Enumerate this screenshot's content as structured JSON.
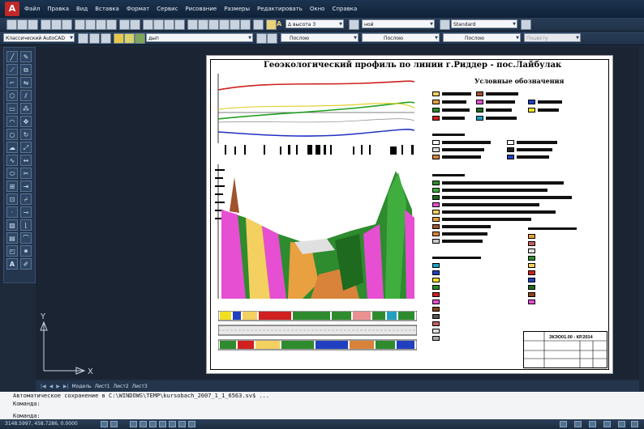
{
  "app": {
    "logo_text": "A"
  },
  "menu": [
    "Файл",
    "Правка",
    "Вид",
    "Вставка",
    "Формат",
    "Сервис",
    "Рисование",
    "Размеры",
    "Редактировать",
    "Окно",
    "Справка"
  ],
  "toolbar1": {
    "dim_style_label": "A",
    "dim_combo": "Δ высота 3",
    "layer_combo": "ной",
    "style_combo": "Standard"
  },
  "toolbar2": {
    "workspace_combo": "Классический AutoCAD",
    "layer_name": "дып",
    "color_combo": "Послою",
    "linetype_combo": "Послою",
    "lineweight_combo": "Послою",
    "plotstyle_combo": "Поцвету"
  },
  "drawing": {
    "ucs_y": "Y",
    "ucs_x": "X",
    "sheet_title": "Геоэкологический профиль по линии г.Риддер - пос.Лайбулак",
    "legend_title": "Условные обозначения",
    "stamp_code": "ЗКЭО01.00 - КР.2014"
  },
  "tabs": [
    "Модель",
    "Лист1",
    "Лист2",
    "Лист3"
  ],
  "command_line": [
    "Автоматическое сохранение в C:\\WINDOWS\\TEMP\\kursobach_2007_1_1_6563.sv$ ...",
    "Команда:",
    "",
    "Команда:"
  ],
  "status": {
    "coordinates": "3148.5997, 458.7286, 0.0000"
  },
  "colors": {
    "profile_green": "#2f8a2f",
    "profile_magenta": "#e64fd2",
    "profile_orange": "#e8a040"
  }
}
